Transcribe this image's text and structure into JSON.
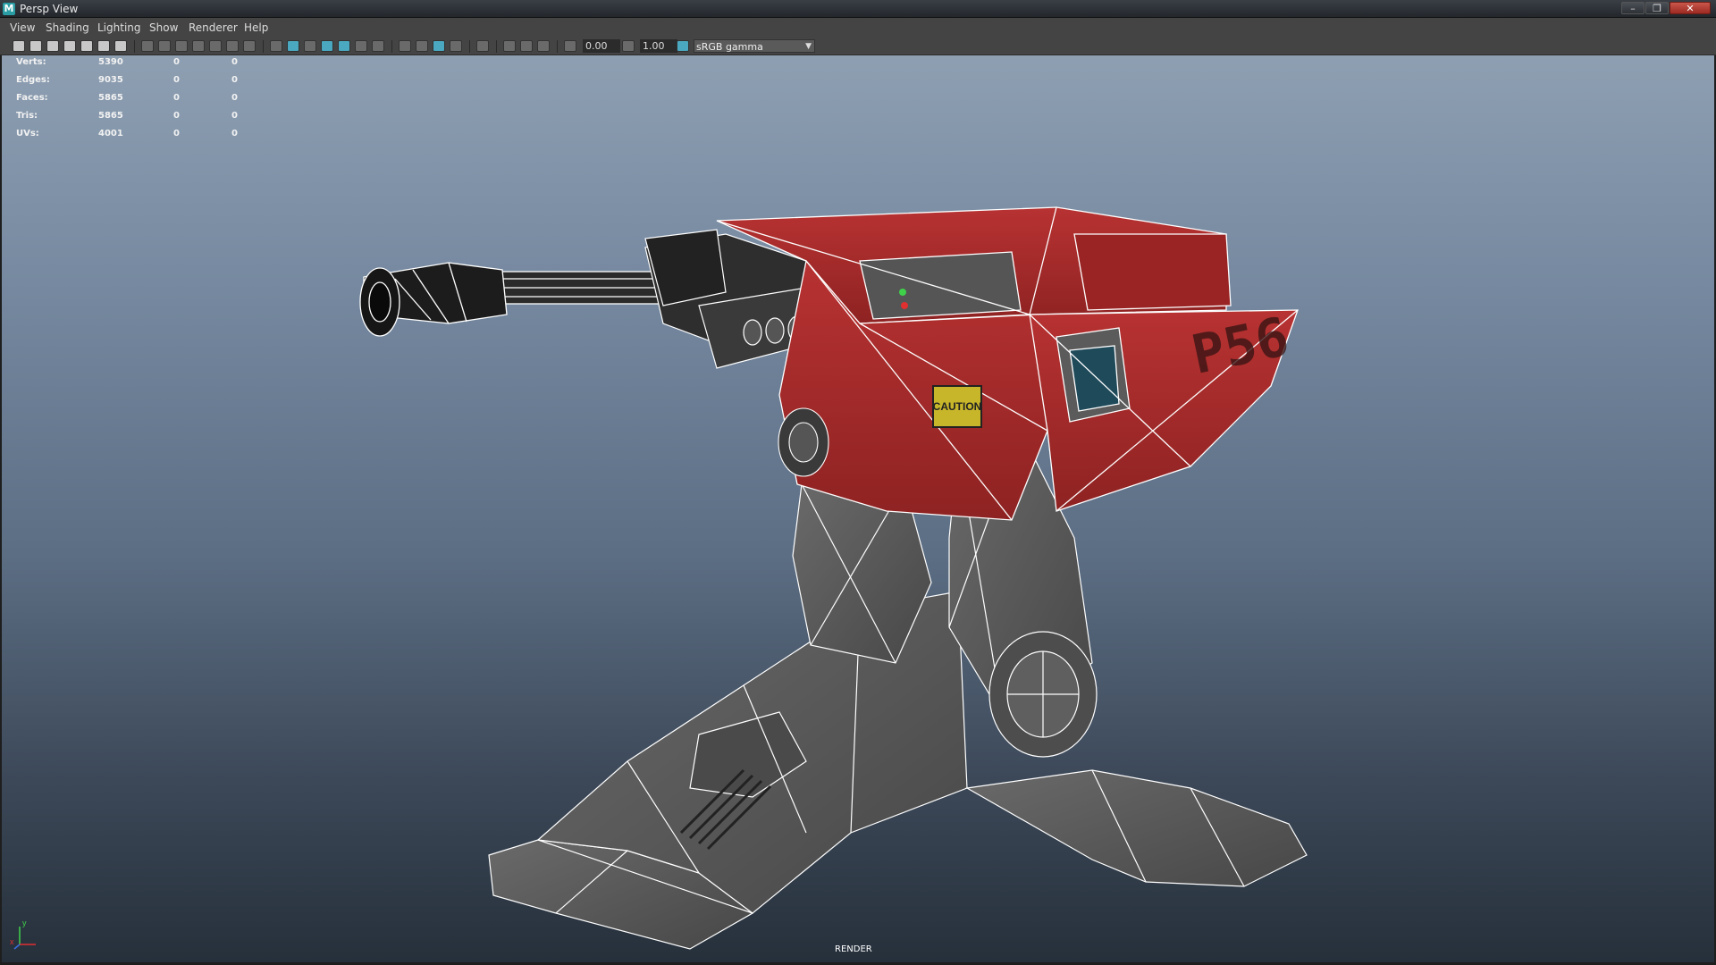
{
  "window": {
    "app_icon": "M",
    "title": "Persp View",
    "min_icon": "minimize-icon",
    "max_icon": "maximize-icon",
    "close_icon": "close-icon",
    "min_glyph": "–",
    "max_glyph": "❐",
    "close_glyph": "✕"
  },
  "menu": [
    "View",
    "Shading",
    "Lighting",
    "Show",
    "Renderer",
    "Help"
  ],
  "toolbar": {
    "exposure_value": "0.00",
    "gamma_value": "1.00",
    "color_space": "sRGB gamma",
    "accent": "#4aa8c0"
  },
  "hud": {
    "rows": [
      {
        "label": "Verts:",
        "v1": "5390",
        "v2": "0",
        "v3": "0"
      },
      {
        "label": "Edges:",
        "v1": "9035",
        "v2": "0",
        "v3": "0"
      },
      {
        "label": "Faces:",
        "v1": "5865",
        "v2": "0",
        "v3": "0"
      },
      {
        "label": "Tris:",
        "v1": "5865",
        "v2": "0",
        "v3": "0"
      },
      {
        "label": "UVs:",
        "v1": "4001",
        "v2": "0",
        "v3": "0"
      }
    ]
  },
  "model": {
    "caution_text": "CAUTION",
    "panel_text": "P56",
    "body_color": "#a82a2a",
    "leg_color": "#5a5a5a"
  },
  "axis": {
    "y_label": "y",
    "x_label": "x"
  },
  "viewport": {
    "footer_label": "RENDER"
  }
}
